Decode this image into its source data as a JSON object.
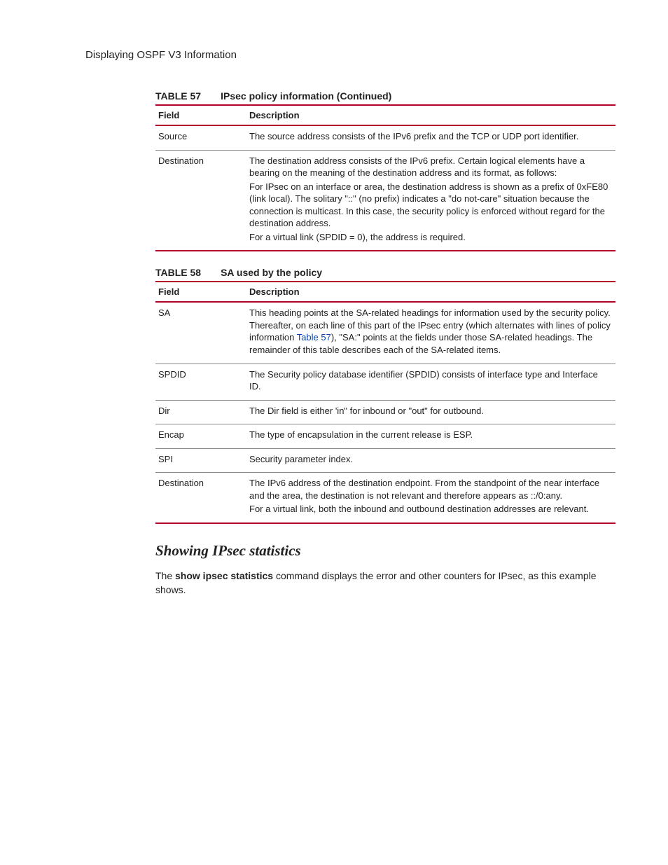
{
  "section_title": "Displaying OSPF V3 Information",
  "tables": {
    "t57": {
      "number": "TABLE 57",
      "title": "IPsec policy information  (Continued)",
      "head_field": "Field",
      "head_desc": "Description",
      "rows": [
        {
          "field": "Source",
          "desc": [
            "The source address consists of the IPv6 prefix and the TCP or UDP port identifier."
          ]
        },
        {
          "field": "Destination",
          "desc": [
            "The destination address consists of the IPv6 prefix.  Certain logical elements have a bearing on the meaning of the destination address and its format, as follows:",
            "For IPsec on an interface or area, the destination address is shown as a prefix of 0xFE80 (link local). The solitary \"::\" (no prefix) indicates a \"do not-care\" situation because the connection is multicast. In this case, the security policy is enforced without regard for the destination address.",
            "For a virtual link (SPDID = 0), the address is required."
          ]
        }
      ]
    },
    "t58": {
      "number": "TABLE 58",
      "title": "SA used by the policy",
      "head_field": "Field",
      "head_desc": "Description",
      "crossref": "Table 57",
      "rows": [
        {
          "field": "SA",
          "desc_pre": "This heading points at the SA-related headings for information used by the security policy.  Thereafter, on each line of this part of the IPsec entry (which alternates with lines of policy information ",
          "desc_post": "), \"SA:\" points at the fields under those SA-related headings.  The remainder of this table describes each of the SA-related items."
        },
        {
          "field": "SPDID",
          "desc": [
            "The Security policy database identifier (SPDID) consists of interface type and Interface ID."
          ]
        },
        {
          "field": "Dir",
          "desc": [
            "The Dir field is either 'in\" for inbound or \"out\" for outbound."
          ]
        },
        {
          "field": "Encap",
          "desc": [
            "The type of encapsulation in the current release is ESP."
          ]
        },
        {
          "field": "SPI",
          "desc": [
            "Security parameter index."
          ]
        },
        {
          "field": "Destination",
          "desc": [
            "The IPv6 address of the destination endpoint.  From the standpoint of the near interface and the area, the destination is not relevant and therefore appears as ::/0:any.",
            "For a virtual link, both the inbound and outbound destination addresses are relevant."
          ]
        }
      ]
    }
  },
  "subhead": "Showing IPsec statistics",
  "body": {
    "pre": "The ",
    "bold": "show ipsec statistics",
    "post": " command displays the error and other counters for IPsec, as this example shows."
  }
}
